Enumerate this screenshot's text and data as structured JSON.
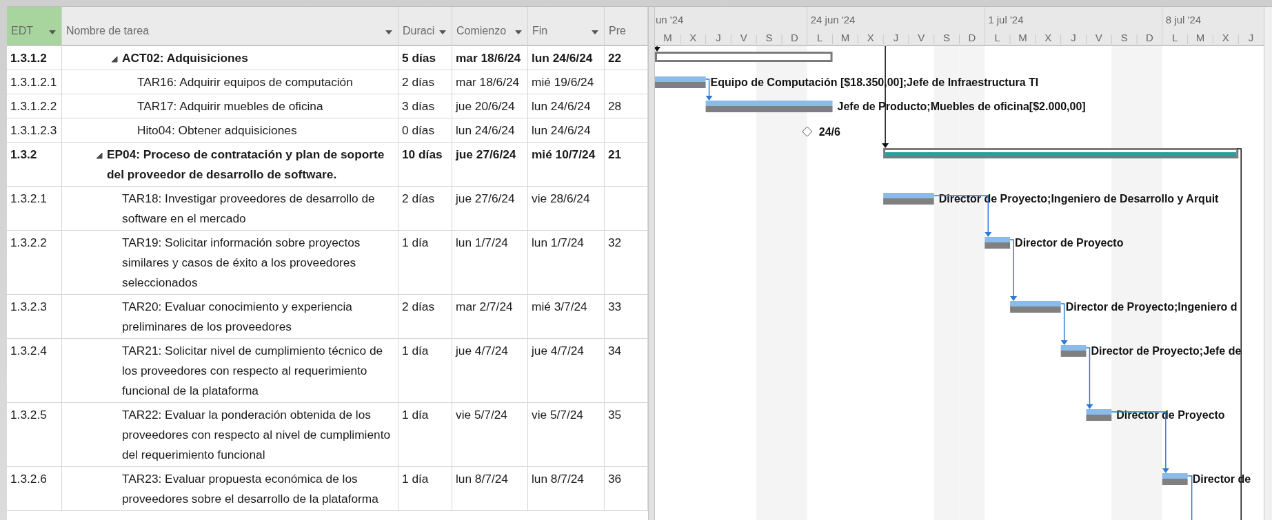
{
  "columns": [
    {
      "label": "EDT",
      "selected": true,
      "filter": true
    },
    {
      "label": "Nombre de tarea",
      "selected": false,
      "filter": true
    },
    {
      "label": "Duraci",
      "selected": false,
      "filter": true
    },
    {
      "label": "Comienzo",
      "selected": false,
      "filter": true
    },
    {
      "label": "Fin",
      "selected": false,
      "filter": true
    },
    {
      "label": "Pre",
      "selected": false,
      "filter": false
    }
  ],
  "timescale": {
    "weeks": [
      "un '24",
      "24 jun '24",
      "1 jul '24",
      "8 jul '24"
    ],
    "days": [
      {
        "label": "M",
        "nonworking": false
      },
      {
        "label": "X",
        "nonworking": false
      },
      {
        "label": "J",
        "nonworking": false
      },
      {
        "label": "V",
        "nonworking": false
      },
      {
        "label": "S",
        "nonworking": true
      },
      {
        "label": "D",
        "nonworking": true
      },
      {
        "label": "L",
        "nonworking": false
      },
      {
        "label": "M",
        "nonworking": false
      },
      {
        "label": "X",
        "nonworking": false
      },
      {
        "label": "J",
        "nonworking": false
      },
      {
        "label": "V",
        "nonworking": false
      },
      {
        "label": "S",
        "nonworking": true
      },
      {
        "label": "D",
        "nonworking": true
      },
      {
        "label": "L",
        "nonworking": false
      },
      {
        "label": "M",
        "nonworking": false
      },
      {
        "label": "X",
        "nonworking": false
      },
      {
        "label": "J",
        "nonworking": false
      },
      {
        "label": "V",
        "nonworking": false
      },
      {
        "label": "S",
        "nonworking": true
      },
      {
        "label": "D",
        "nonworking": true
      },
      {
        "label": "L",
        "nonworking": false
      },
      {
        "label": "M",
        "nonworking": false
      },
      {
        "label": "X",
        "nonworking": false
      },
      {
        "label": "J",
        "nonworking": false
      }
    ]
  },
  "rows": [
    {
      "kind": "summary",
      "edt": "1.3.1.2",
      "name": "ACT02: Adquisiciones",
      "duration": "5 días",
      "start": "mar 18/6/24",
      "finish": "lun 24/6/24",
      "pred": "22",
      "expanded": true,
      "highlighted": false,
      "children": [
        {
          "kind": "task",
          "edt": "1.3.1.2.1",
          "name": "TAR16: Adquirir equipos de computación",
          "duration": "2 días",
          "start": "mar 18/6/24",
          "finish": "mié 19/6/24",
          "bar_label": "Equipo de Computación [$18.350,00];Jefe de Infraestructura TI"
        },
        {
          "kind": "task",
          "edt": "1.3.1.2.2",
          "name": "TAR17: Adquirir muebles de oficina",
          "duration": "3 días",
          "start": "jue 20/6/24",
          "finish": "lun 24/6/24",
          "pred": "28",
          "bar_label": "Jefe de Producto;Muebles de oficina[$2.000,00]"
        },
        {
          "kind": "milestone",
          "edt": "1.3.1.2.3",
          "name": "Hito04: Obtener adquisiciones",
          "duration": "0 días",
          "start": "lun 24/6/24",
          "finish": "lun 24/6/24",
          "bar_label": "24/6"
        }
      ]
    },
    {
      "kind": "summary",
      "edt": "1.3.2",
      "name": "EP04: Proceso de contratación y plan de soporte del proveedor de desarrollo de software.",
      "duration": "10 días",
      "start": "jue 27/6/24",
      "finish": "mié 10/7/24",
      "pred": "21",
      "expanded": true,
      "highlighted": true,
      "children": [
        {
          "kind": "task",
          "edt": "1.3.2.1",
          "name": "TAR18: Investigar proveedores de desarrollo de software en el mercado",
          "duration": "2 días",
          "start": "jue 27/6/24",
          "finish": "vie 28/6/24",
          "bar_label": "Director de Proyecto;Ingeniero de Desarrollo y Arquit"
        },
        {
          "kind": "task",
          "edt": "1.3.2.2",
          "name": "TAR19: Solicitar información sobre proyectos similares y casos de éxito a los proveedores seleccionados",
          "duration": "1 día",
          "start": "lun 1/7/24",
          "finish": "lun 1/7/24",
          "pred": "32",
          "bar_label": "Director de Proyecto"
        },
        {
          "kind": "task",
          "edt": "1.3.2.3",
          "name": "TAR20: Evaluar conocimiento y experiencia preliminares de los proveedores",
          "duration": "2 días",
          "start": "mar 2/7/24",
          "finish": "mié 3/7/24",
          "pred": "33",
          "bar_label": "Director de Proyecto;Ingeniero d"
        },
        {
          "kind": "task",
          "edt": "1.3.2.4",
          "name": "TAR21: Solicitar nivel de cumplimiento técnico de los proveedores con respecto al requerimiento funcional de la plataforma",
          "duration": "1 día",
          "start": "jue 4/7/24",
          "finish": "jue 4/7/24",
          "pred": "34",
          "bar_label": "Director de Proyecto;Jefe de"
        },
        {
          "kind": "task",
          "edt": "1.3.2.5",
          "name": "TAR22: Evaluar la ponderación obtenida de los proveedores con respecto al nivel de cumplimiento del requerimiento funcional",
          "duration": "1 día",
          "start": "vie 5/7/24",
          "finish": "vie 5/7/24",
          "pred": "35",
          "bar_label": "Director de Proyecto"
        },
        {
          "kind": "task",
          "edt": "1.3.2.6",
          "name": "TAR23: Evaluar propuesta económica de los proveedores sobre el desarrollo de la plataforma",
          "duration": "1 día",
          "start": "lun 8/7/24",
          "finish": "lun 8/7/24",
          "pred": "36",
          "bar_label": "Director de"
        }
      ]
    }
  ]
}
